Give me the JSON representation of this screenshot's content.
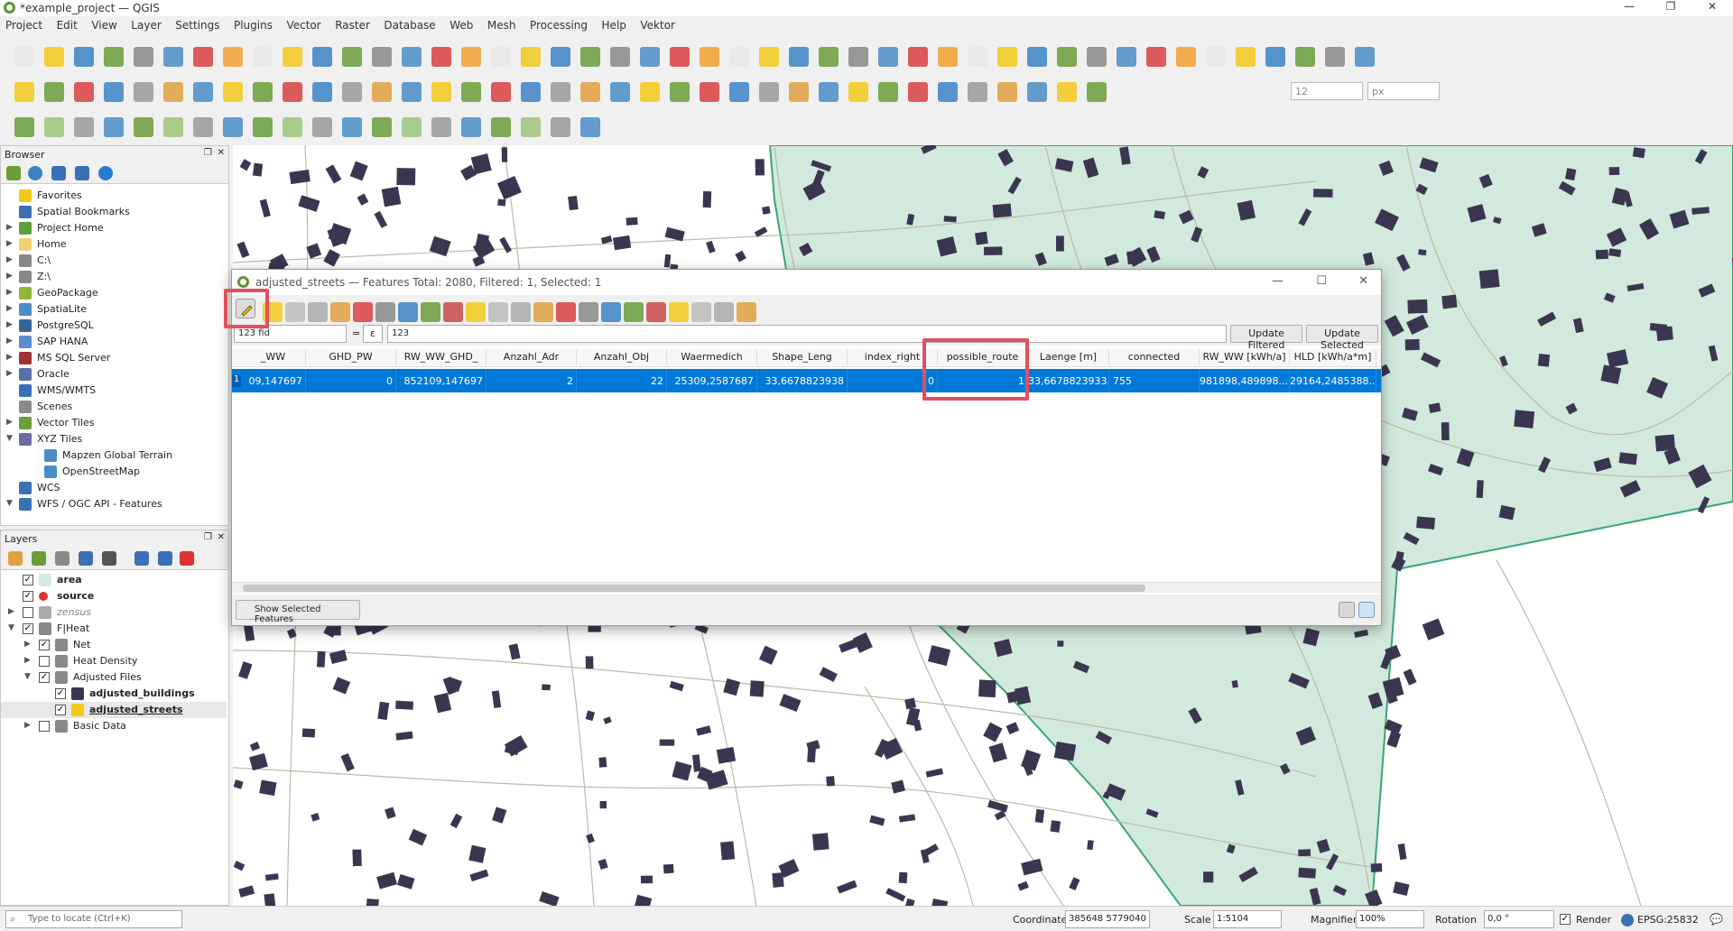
{
  "window": {
    "title": "*example_project — QGIS",
    "controls": [
      "—",
      "❐",
      "✕"
    ]
  },
  "menu": [
    "Project",
    "Edit",
    "View",
    "Layer",
    "Settings",
    "Plugins",
    "Vector",
    "Raster",
    "Database",
    "Web",
    "Mesh",
    "Processing",
    "Help",
    "Vektor"
  ],
  "style": {
    "accent": "#0078d7",
    "highlight": "#e34f5c",
    "area_fill": "#d0eadf",
    "building": "#3b3650"
  },
  "toolbar": {
    "font_size": "12",
    "font_unit": "px"
  },
  "browser": {
    "title": "Browser",
    "items": [
      {
        "label": "Favorites",
        "icon": "star-icon",
        "color": "#f2c81a"
      },
      {
        "label": "Spatial Bookmarks",
        "icon": "bookmark-icon",
        "color": "#3b6fb6"
      },
      {
        "label": "Project Home",
        "icon": "folder-icon",
        "color": "#5b9e3a"
      },
      {
        "label": "Home",
        "icon": "folder-icon",
        "color": "#f0d070"
      },
      {
        "label": "C:\\",
        "icon": "drive-icon",
        "color": "#888888"
      },
      {
        "label": "Z:\\",
        "icon": "drive-icon",
        "color": "#888888"
      },
      {
        "label": "GeoPackage",
        "icon": "geopackage-icon",
        "color": "#8fb83b"
      },
      {
        "label": "SpatiaLite",
        "icon": "spatialite-icon",
        "color": "#4b8cc7"
      },
      {
        "label": "PostgreSQL",
        "icon": "postgres-icon",
        "color": "#336791"
      },
      {
        "label": "SAP HANA",
        "icon": "hana-icon",
        "color": "#5a8ed0"
      },
      {
        "label": "MS SQL Server",
        "icon": "mssql-icon",
        "color": "#a03232"
      },
      {
        "label": "Oracle",
        "icon": "oracle-icon",
        "color": "#5a6fa5"
      },
      {
        "label": "WMS/WMTS",
        "icon": "globe-icon",
        "color": "#3b6fb6"
      },
      {
        "label": "Scenes",
        "icon": "scene-icon",
        "color": "#8a8a8a"
      },
      {
        "label": "Vector Tiles",
        "icon": "tiles-icon",
        "color": "#6a9c3a"
      },
      {
        "label": "XYZ Tiles",
        "icon": "tiles-icon",
        "color": "#6a6aa5"
      },
      {
        "label": "Mapzen Global Terrain",
        "icon": "grid-icon",
        "color": "#4b8cc7"
      },
      {
        "label": "OpenStreetMap",
        "icon": "grid-icon",
        "color": "#4b8cc7"
      },
      {
        "label": "WCS",
        "icon": "globe-icon",
        "color": "#3b6fb6"
      },
      {
        "label": "WFS / OGC API - Features",
        "icon": "wfs-icon",
        "color": "#3b6fb6"
      }
    ]
  },
  "layers": {
    "title": "Layers",
    "items": [
      {
        "label": "area",
        "checked": true,
        "bold": true
      },
      {
        "label": "source",
        "checked": true,
        "bold": true
      },
      {
        "label": "zensus",
        "checked": false,
        "italic": true
      },
      {
        "label": "F|Heat",
        "checked": true
      },
      {
        "label": "Net",
        "checked": true
      },
      {
        "label": "Heat Density",
        "checked": false
      },
      {
        "label": "Adjusted Files",
        "checked": true
      },
      {
        "label": "adjusted_buildings",
        "checked": true,
        "bold": true
      },
      {
        "label": "adjusted_streets",
        "checked": true,
        "bold": true,
        "underline": true
      },
      {
        "label": "Basic Data",
        "checked": false
      }
    ],
    "check_mark": "✓"
  },
  "attr_table": {
    "title": "adjusted_streets — Features Total: 2080, Filtered: 1, Selected: 1",
    "field_select": "123 fid",
    "operator": "=",
    "epsilon": "ε",
    "expression": "123",
    "update_filtered": "Update Filtered",
    "update_selected": "Update Selected",
    "columns": [
      "_WW",
      "GHD_PW",
      "RW_WW_GHD_",
      "Anzahl_Adr",
      "Anzahl_Obj",
      "Waermedich",
      "Shape_Leng",
      "index_right",
      "possible_route",
      "Laenge [m]",
      "connected",
      "RW_WW [kWh/a]",
      "HLD [kWh/a*m]"
    ],
    "row_number": "1",
    "row": [
      "09,147697",
      "0",
      "852109,147697",
      "2",
      "22",
      "25309,2587687",
      "33,6678823938",
      "0",
      "1",
      "33,6678823933...",
      "755",
      "981898,489898...",
      "29164,2485388..."
    ],
    "show_selected": "Show Selected Features"
  },
  "statusbar": {
    "locate_placeholder": "Type to locate (Ctrl+K)",
    "coordinate_label": "Coordinate",
    "coordinate": "385648  5779040",
    "scale_label": "Scale",
    "scale": "1:5104",
    "magnifier_label": "Magnifier",
    "magnifier": "100%",
    "rotation_label": "Rotation",
    "rotation": "0,0 °",
    "render_label": "Render",
    "crs": "EPSG:25832"
  }
}
